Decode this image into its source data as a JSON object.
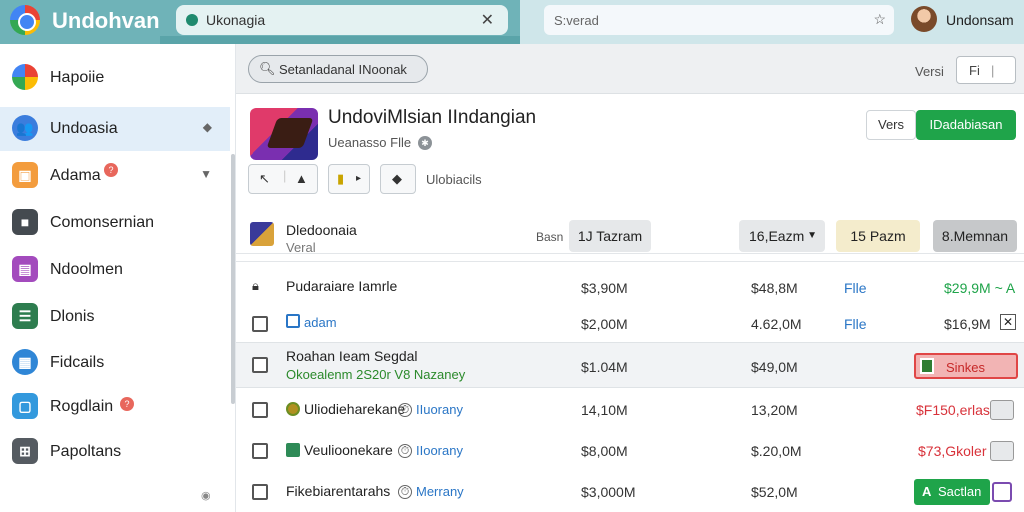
{
  "topbar": {
    "app_title": "Undohvan",
    "tab_label": "Ukonagia",
    "address_placeholder": "S:verad",
    "user_name": "Undonsam"
  },
  "sidebar": {
    "items": [
      {
        "label": "Hapoiie",
        "icon": "google-icon",
        "color": "#ffffff"
      },
      {
        "label": "Undoasia",
        "icon": "people-icon",
        "color": "#3b7ddd"
      },
      {
        "label": "Adama",
        "icon": "box-icon",
        "color": "#f39c3d",
        "badge": "?"
      },
      {
        "label": "Comonsernian",
        "icon": "puzzle-icon",
        "color": "#444a50"
      },
      {
        "label": "Ndoolmen",
        "icon": "chat-icon",
        "color": "#a34bbd"
      },
      {
        "label": "Dlonis",
        "icon": "doc-icon",
        "color": "#2e7d4f"
      },
      {
        "label": "Fidcails",
        "icon": "grid-icon",
        "color": "#2f86d6"
      },
      {
        "label": "Rogdlain",
        "icon": "frame-icon",
        "color": "#3399dd",
        "badge": "?"
      },
      {
        "label": "Papoltans",
        "icon": "apps-icon",
        "color": "#555b61"
      }
    ]
  },
  "search": {
    "placeholder": "Setanladanal INoonak"
  },
  "toolbar_right": {
    "versi_label": "Versi",
    "filter_label": "Fi"
  },
  "header": {
    "title": "UndoviMlsian IIndangian",
    "subtitle": "Ueanasso Flle",
    "vers_button": "Vers",
    "primary_button": "IDadabiasan",
    "tool_label": "Ulobiacils"
  },
  "subheader": {
    "title": "Dledoonaia",
    "subtitle": "Veral",
    "filter_label": "Basn",
    "chips": [
      {
        "label": "1J Tazram",
        "bg": "#e6e8ea"
      },
      {
        "label": "16,Eazm",
        "bg": "#e6e8ea",
        "dropdown": true
      },
      {
        "label": "15 Pazm",
        "bg": "#f4eccc"
      },
      {
        "label": "8.Memnan",
        "bg": "#c6c8ca"
      }
    ]
  },
  "rows": [
    {
      "name": "Pudaraiare Iamrle",
      "icon": "lock-icon",
      "col1": "$3,90M",
      "col2": "$48,8M",
      "col3": "Flle",
      "amount": "$29,9M ~ A",
      "amount_color": "#1fa44a"
    },
    {
      "name": "adam",
      "icon": "checkbox-icon",
      "col1": "$2,00M",
      "col2": "4.62,0M",
      "col3": "Flle",
      "amount": "$16,9M",
      "amount_color": "#333333"
    },
    {
      "name": "Roahan Ieam Segdal",
      "sub": "Okoealenm 2S20r V8 Nazaney",
      "col1": "$1.04M",
      "col2": "$49,0M",
      "action": "Sinkes",
      "action_color": "#e04646"
    },
    {
      "name": "Uliodieharekane",
      "meta": "IIuorany",
      "col1": "14,10M",
      "col2": "13,20M",
      "amount": "$F150,erlas",
      "amount_color": "#d8323a"
    },
    {
      "name": "Veulioonekare",
      "meta": "IIoorany",
      "col1": "$8,00M",
      "col2": "$.20,0M",
      "amount": "$73,Gkoler",
      "amount_color": "#d8323a"
    },
    {
      "name": "Fikebiarentarahs",
      "meta": "Merrany",
      "col1": "$3,000M",
      "col2": "$52,0M",
      "action": "Sactlan",
      "action_color": "#1fa44a"
    }
  ]
}
